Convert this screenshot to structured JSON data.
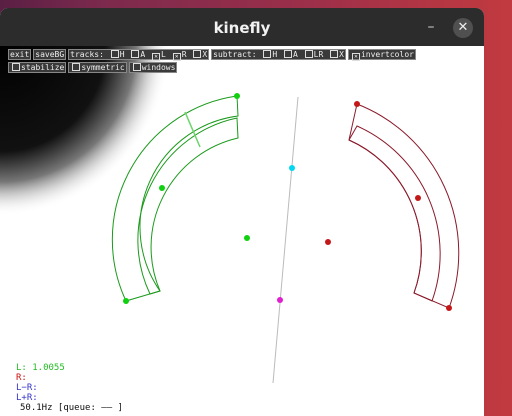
{
  "window": {
    "title": "kinefly"
  },
  "toolbar": {
    "exit": "exit",
    "savebg": "saveBG",
    "tracks_label": "tracks:",
    "tracks": [
      {
        "label": "H",
        "checked": false
      },
      {
        "label": "A",
        "checked": false
      },
      {
        "label": "L",
        "checked": true
      },
      {
        "label": "R",
        "checked": true
      },
      {
        "label": "X",
        "checked": false
      }
    ],
    "subtract_label": "subtract:",
    "subtract": [
      {
        "label": "H",
        "checked": false
      },
      {
        "label": "A",
        "checked": false
      },
      {
        "label": "LR",
        "checked": false
      },
      {
        "label": "X",
        "checked": false
      }
    ],
    "invertcolor": {
      "label": "invertcolor",
      "checked": true
    },
    "stabilize": {
      "label": "stabilize",
      "checked": false
    },
    "symmetric": {
      "label": "symmetric",
      "checked": false
    },
    "windows": {
      "label": "windows",
      "checked": false
    }
  },
  "readouts": {
    "left": "L: 1.0055",
    "right": "R:",
    "diff": "L−R:",
    "sum": "L+R:",
    "rate": "50.1Hz [queue: ——     ]"
  },
  "colors": {
    "left_wing": "#1a9a1a",
    "right_wing": "#8b1a2a",
    "center_handle": "#00cfe0",
    "bottom_handle": "#e020d0",
    "left_text": "#22bb22",
    "right_text": "#cc1111",
    "diff_text": "#3333cc"
  }
}
